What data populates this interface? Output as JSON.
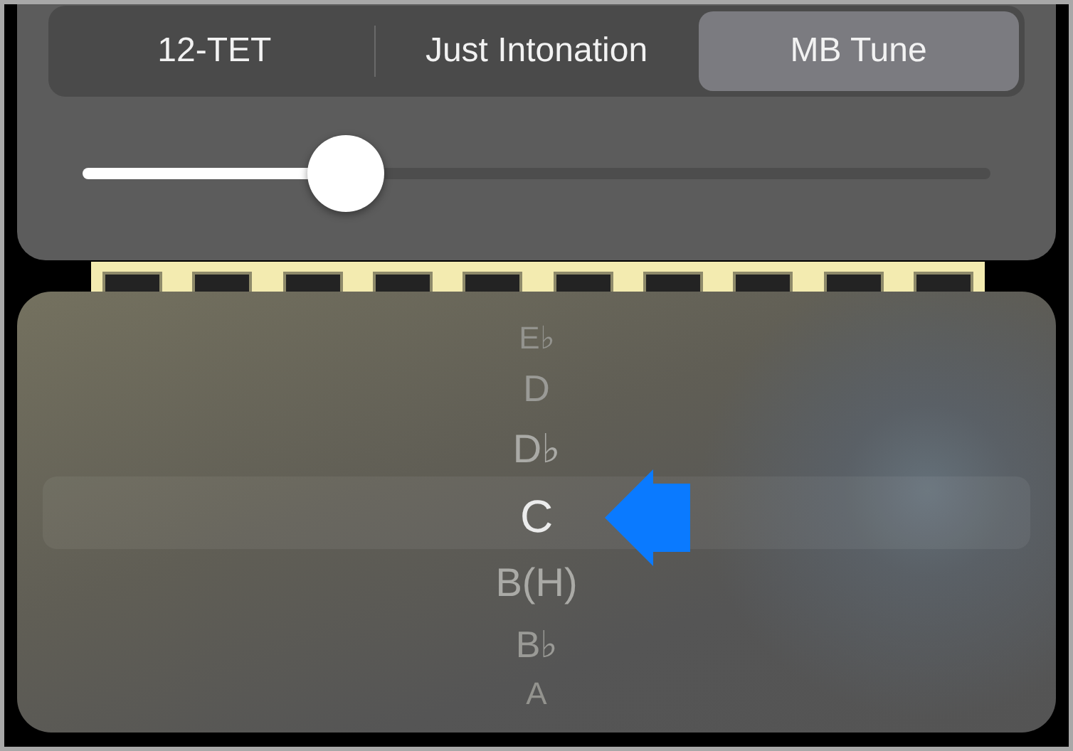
{
  "tuning_modes": [
    {
      "label": "12-TET",
      "selected": false
    },
    {
      "label": "Just Intonation",
      "selected": false
    },
    {
      "label": "MB Tune",
      "selected": true
    }
  ],
  "slider": {
    "level": 0.29
  },
  "key_picker": [
    {
      "label": "E♭",
      "selected": false
    },
    {
      "label": "D",
      "selected": false
    },
    {
      "label": "D♭",
      "selected": false
    },
    {
      "label": "C",
      "selected": true
    },
    {
      "label": "B(H)",
      "selected": false
    },
    {
      "label": "B♭",
      "selected": false
    },
    {
      "label": "A",
      "selected": false
    }
  ]
}
